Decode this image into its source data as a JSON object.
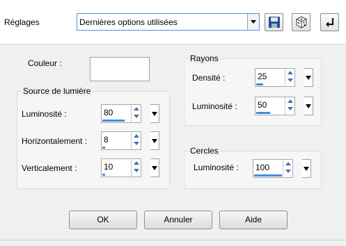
{
  "presets": {
    "label": "Réglages",
    "value": "Dernières options utilisées",
    "save_icon": "save-icon",
    "randomize_icon": "dice-icon",
    "reset_icon": "reset-arrow-icon"
  },
  "color": {
    "label": "Couleur :",
    "value": "#ffffff"
  },
  "light_source": {
    "title": "Source de lumière",
    "brightness": {
      "label": "Luminosité :",
      "value": "80",
      "level": 80
    },
    "horizontal": {
      "label": "Horizontalement :",
      "value": "8",
      "level": 8
    },
    "vertical": {
      "label": "Verticalement :",
      "value": "10",
      "level": 10
    }
  },
  "rays": {
    "title": "Rayons",
    "density": {
      "label": "Densité :",
      "value": "25",
      "level": 25
    },
    "brightness": {
      "label": "Luminosité :",
      "value": "50",
      "level": 50
    }
  },
  "circles": {
    "title": "Cercles",
    "brightness": {
      "label": "Luminosité :",
      "value": "100",
      "level": 100
    }
  },
  "buttons": {
    "ok": "OK",
    "cancel": "Annuler",
    "help": "Aide"
  },
  "colors": {
    "accent": "#3d8ee0",
    "window_bg": "#f0f0f0"
  }
}
